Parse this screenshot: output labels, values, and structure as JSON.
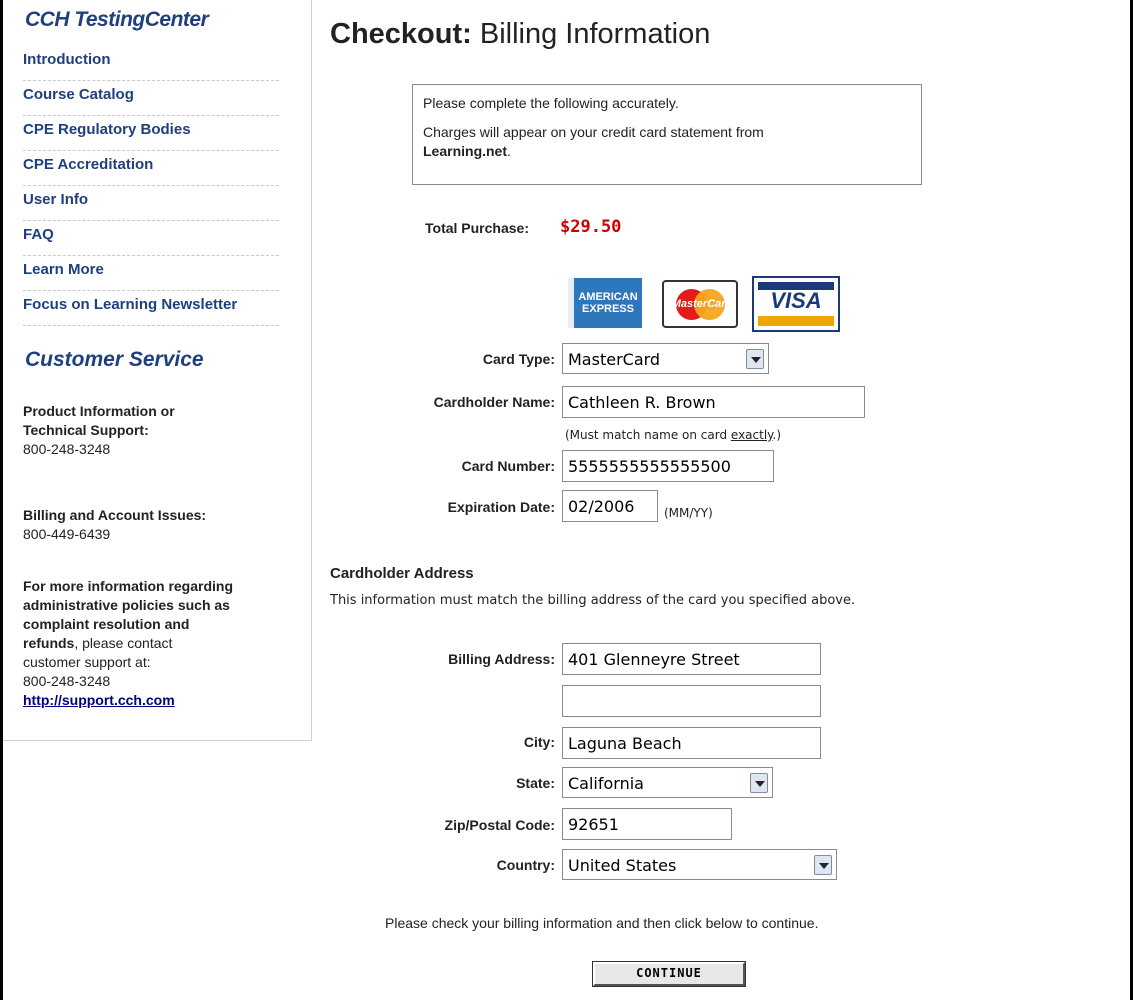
{
  "sidebar": {
    "brand": "CCH TestingCenter",
    "nav_items": [
      "Introduction",
      "Course Catalog",
      "CPE Regulatory Bodies",
      "CPE Accreditation",
      "User Info",
      "FAQ",
      "Learn More",
      "Focus on Learning Newsletter"
    ],
    "customer_service_title": "Customer Service",
    "product_info_label_1": "Product Information or",
    "product_info_label_2": "Technical Support:",
    "product_info_phone": "800-248-3248",
    "billing_label": "Billing and Account Issues:",
    "billing_phone": "800-449-6439",
    "policy_text_1": "For more information regarding",
    "policy_text_2": "administrative policies such as",
    "policy_text_3": "complaint resolution and",
    "policy_text_4_bold": "refunds",
    "policy_text_4_rest": ", please contact",
    "policy_text_5": "customer support at:",
    "policy_phone": "800-248-3248",
    "support_link": "http://support.cch.com"
  },
  "main": {
    "title_bold": "Checkout:",
    "title_rest": " Billing Information",
    "notice_line_1": "Please complete the following accurately.",
    "notice_line_2a": "Charges will appear on your credit card statement from",
    "notice_line_2b": "Learning.net",
    "notice_line_2c": ".",
    "total_label": "Total Purchase:",
    "total_value": "$29.50",
    "card_logos": {
      "amex_1": "AMERICAN",
      "amex_2": "EXPRESS",
      "mastercard": "MasterCard",
      "visa": "VISA"
    },
    "card_type_label": "Card Type:",
    "card_type_value": "MasterCard",
    "cardholder_name_label": "Cardholder Name:",
    "cardholder_name_value": "Cathleen R. Brown",
    "name_hint_pre": "(Must match name on card ",
    "name_hint_link": "exactly",
    "name_hint_post": ".)",
    "card_number_label": "Card Number:",
    "card_number_value": "5555555555555500",
    "expiration_label": "Expiration Date:",
    "expiration_value": "02/2006",
    "expiration_hint": "(MM/YY)",
    "address_title": "Cardholder Address",
    "address_sub": "This information must match the billing address of the card you specified above.",
    "billing_address_label": "Billing Address:",
    "billing_address_1": "401 Glenneyre Street",
    "billing_address_2": "",
    "city_label": "City:",
    "city_value": "Laguna Beach",
    "state_label": "State:",
    "state_value": "California",
    "zip_label": "Zip/Postal Code:",
    "zip_value": "92651",
    "country_label": "Country:",
    "country_value": "United States",
    "footer_note": "Please check your billing information and then click below to continue.",
    "continue_label": "CONTINUE"
  }
}
